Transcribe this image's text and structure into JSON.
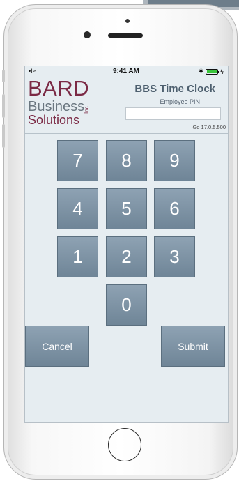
{
  "status_bar": {
    "signal": "•ıl",
    "wifi": "≈",
    "time": "9:41 AM",
    "bluetooth": "✱",
    "battery_level": 1.0
  },
  "logo": {
    "line1": "BARD",
    "line2": "Business",
    "line3": "Solutions",
    "inc": "Inc"
  },
  "header": {
    "title": "BBS Time Clock",
    "pin_label": "Employee PIN",
    "pin_value": "",
    "version": "Go 17.0.5.500"
  },
  "keypad": {
    "keys": [
      "7",
      "8",
      "9",
      "4",
      "5",
      "6",
      "1",
      "2",
      "3",
      "0"
    ],
    "cancel_label": "Cancel",
    "submit_label": "Submit"
  },
  "colors": {
    "brand": "#7b2a45",
    "key_face": "#7d93a5",
    "screen_bg": "#e6edf1"
  }
}
